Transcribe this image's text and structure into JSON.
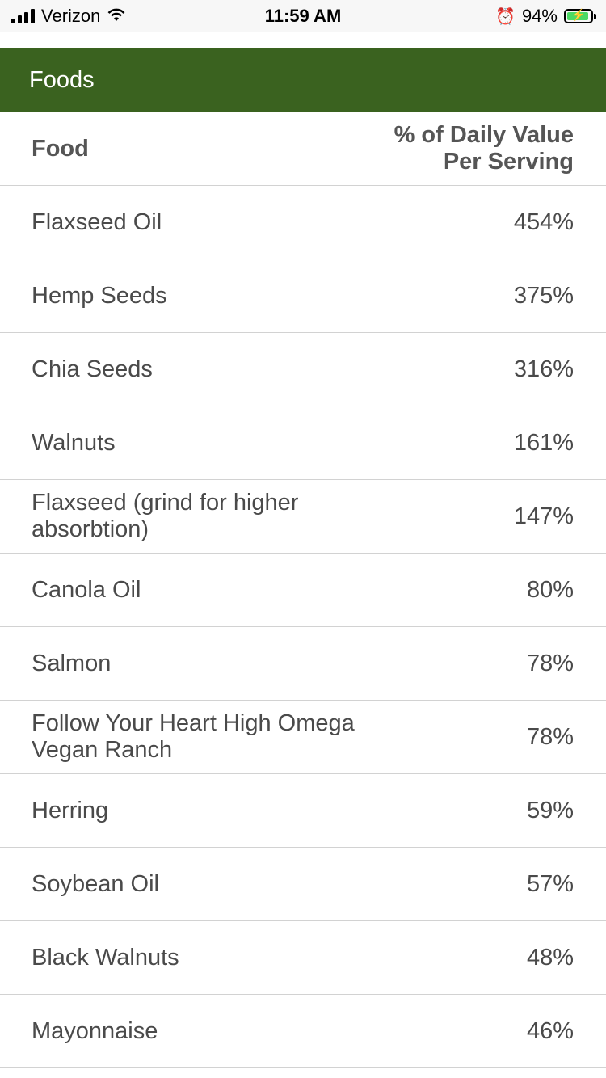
{
  "status_bar": {
    "carrier": "Verizon",
    "time": "11:59 AM",
    "battery_percent": "94%",
    "battery_level": 0.94,
    "icons": [
      "signal-icon",
      "wifi-icon",
      "alarm-icon",
      "battery-charging-icon"
    ]
  },
  "header": {
    "title": "Foods",
    "background_color": "#3a621f"
  },
  "table": {
    "columns": [
      "Food",
      "% of Daily Value Per Serving"
    ],
    "rows": [
      {
        "food": "Flaxseed Oil",
        "value": "454%"
      },
      {
        "food": "Hemp Seeds",
        "value": "375%"
      },
      {
        "food": "Chia Seeds",
        "value": "316%"
      },
      {
        "food": "Walnuts",
        "value": "161%"
      },
      {
        "food": "Flaxseed (grind for higher absorbtion)",
        "value": "147%"
      },
      {
        "food": "Canola Oil",
        "value": "80%"
      },
      {
        "food": "Salmon",
        "value": "78%"
      },
      {
        "food": "Follow Your Heart High Omega Vegan Ranch",
        "value": "78%"
      },
      {
        "food": "Herring",
        "value": "59%"
      },
      {
        "food": "Soybean Oil",
        "value": "57%"
      },
      {
        "food": "Black Walnuts",
        "value": "48%"
      },
      {
        "food": "Mayonnaise",
        "value": "46%"
      }
    ]
  }
}
